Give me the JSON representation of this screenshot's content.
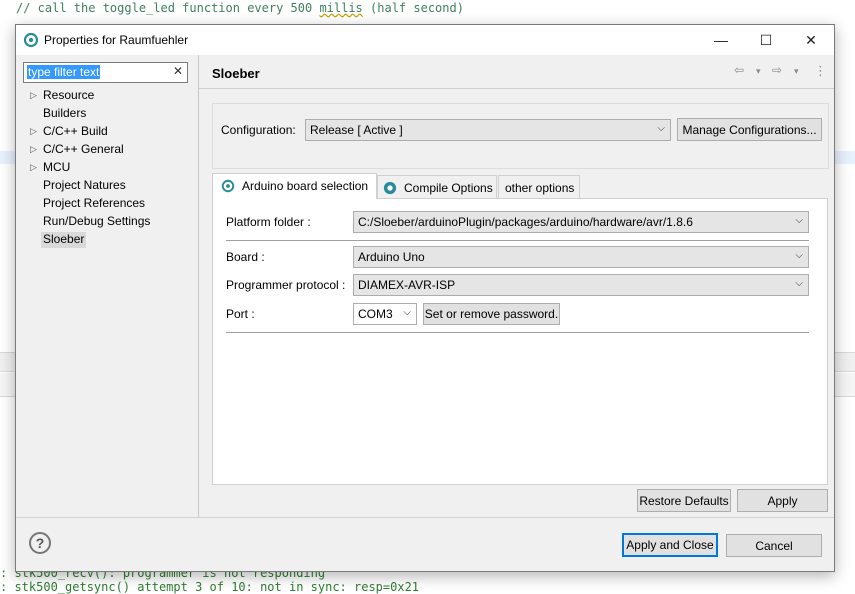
{
  "background": {
    "code_comment_prefix": "// call the toggle_led function every 500 ",
    "code_comment_underlined": "millis",
    "code_comment_suffix": " (half second)",
    "console_lines": [
      ": stk500_recv(): programmer is not responding",
      ": stk500_getsync() attempt 3 of 10: not in sync: resp=0x21"
    ]
  },
  "dialog": {
    "title": "Properties for Raumfuehler",
    "window_buttons": {
      "minimize": "—",
      "maximize": "☐",
      "close": "✕"
    },
    "filter": {
      "placeholder": "type filter text",
      "clear": "✕"
    },
    "tree": [
      {
        "label": "Resource",
        "expandable": true
      },
      {
        "label": "Builders",
        "expandable": false
      },
      {
        "label": "C/C++ Build",
        "expandable": true
      },
      {
        "label": "C/C++ General",
        "expandable": true
      },
      {
        "label": "MCU",
        "expandable": true
      },
      {
        "label": "Project Natures",
        "expandable": false
      },
      {
        "label": "Project References",
        "expandable": false
      },
      {
        "label": "Run/Debug Settings",
        "expandable": false
      },
      {
        "label": "Sloeber",
        "expandable": false,
        "selected": true
      }
    ],
    "page_title": "Sloeber",
    "nav": {
      "back": "⇦",
      "back_menu": "▾",
      "forward": "⇨",
      "forward_menu": "▾",
      "more": "⋮"
    },
    "configuration": {
      "label": "Configuration:",
      "value": "Release  [ Active ]",
      "manage_button": "Manage Configurations..."
    },
    "tabs": [
      {
        "label": "Arduino board selection",
        "active": true,
        "icon": "gear-icon"
      },
      {
        "label": "Compile Options",
        "active": false,
        "icon": "gear-icon"
      },
      {
        "label": "other options",
        "active": false
      }
    ],
    "board_tab": {
      "platform_folder_label": "Platform folder :",
      "platform_folder_value": "C:/Sloeber/arduinoPlugin/packages/arduino/hardware/avr/1.8.6",
      "board_label": "Board :",
      "board_value": "Arduino Uno",
      "programmer_label": "Programmer protocol :",
      "programmer_value": "DIAMEX-AVR-ISP",
      "port_label": "Port :",
      "port_value": "COM3",
      "password_button": "Set or remove password."
    },
    "restore_defaults": "Restore Defaults",
    "apply": "Apply",
    "help_icon": "?",
    "apply_and_close": "Apply and Close",
    "cancel": "Cancel"
  }
}
